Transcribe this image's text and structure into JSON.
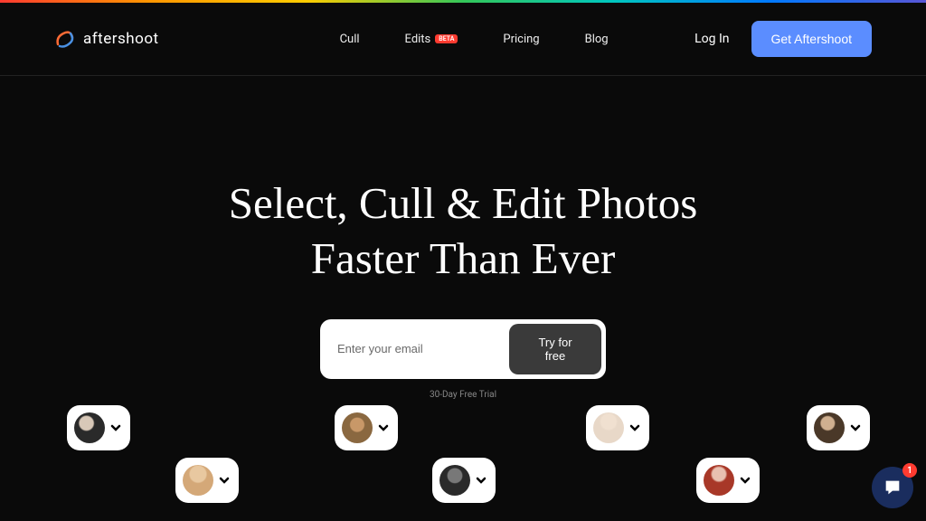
{
  "brand": {
    "name": "aftershoot"
  },
  "nav": {
    "items": [
      {
        "label": "Cull"
      },
      {
        "label": "Edits",
        "badge": "BETA"
      },
      {
        "label": "Pricing"
      },
      {
        "label": "Blog"
      }
    ]
  },
  "header": {
    "login": "Log In",
    "cta": "Get Aftershoot"
  },
  "hero": {
    "title_line1": "Select, Cull & Edit Photos",
    "title_line2": "Faster Than Ever",
    "email_placeholder": "Enter your email",
    "try_button": "Try for free",
    "trial_note": "30-Day Free Trial"
  },
  "chat": {
    "badge_count": "1"
  }
}
